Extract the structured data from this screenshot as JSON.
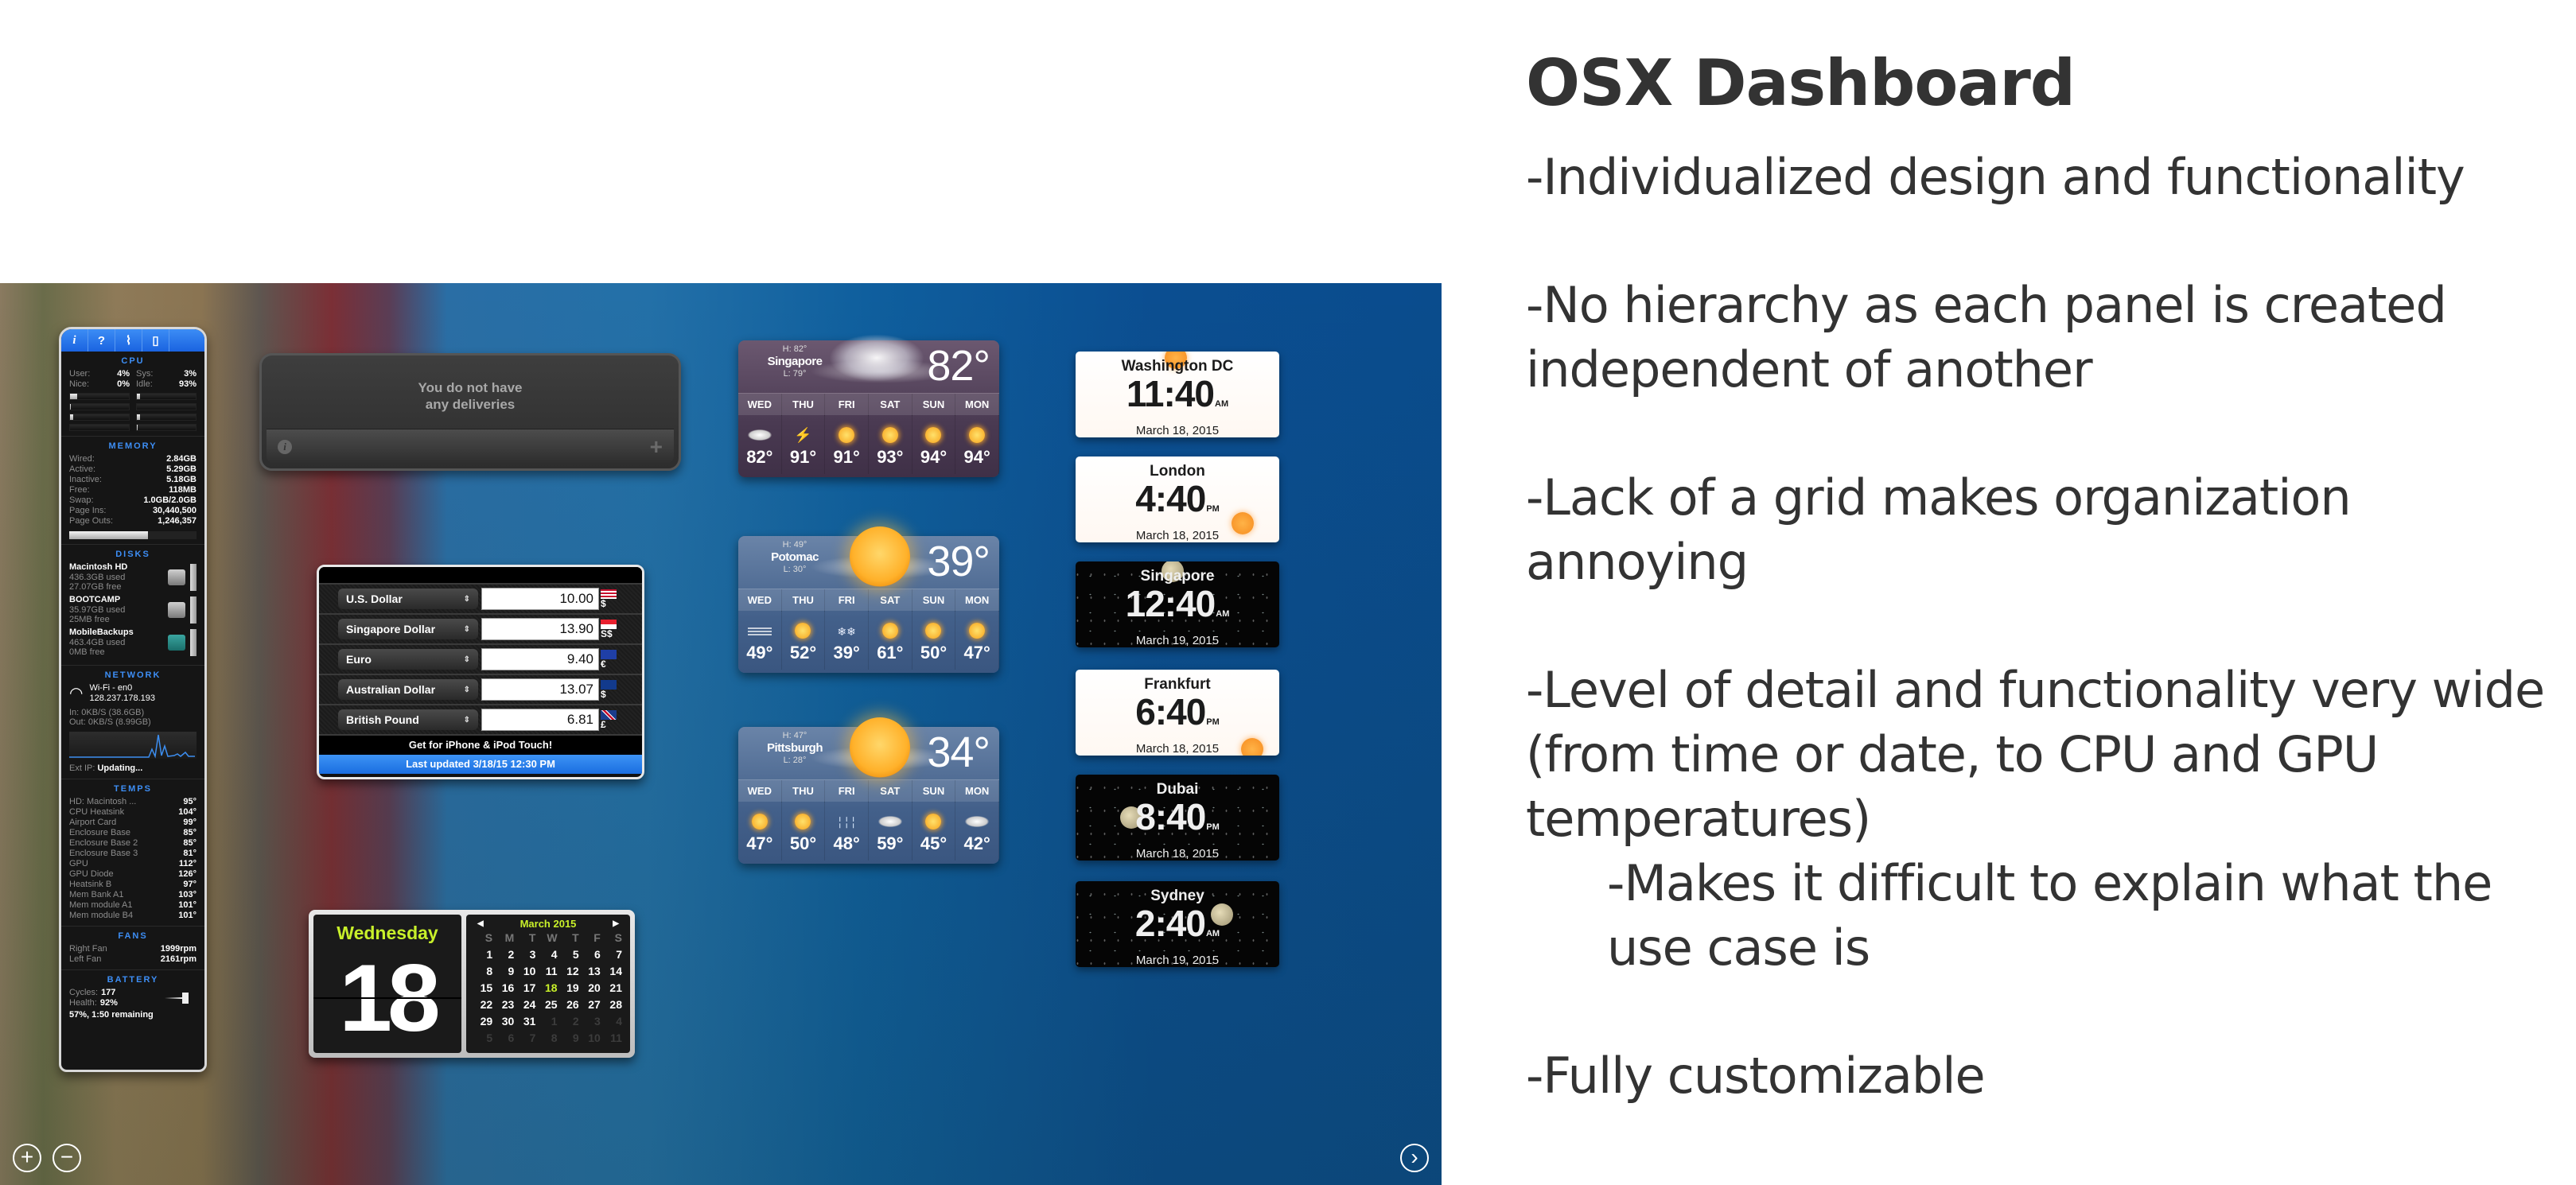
{
  "slide": {
    "title": "OSX Dashboard",
    "bullets": [
      "-Individualized design and functionality",
      "-No hierarchy as each panel is created independent of another",
      "-Lack of a grid makes organization annoying",
      "-Level of detail and functionality very wide (from time or date, to CPU and GPU temperatures)",
      "-Makes it difficult to explain what the use case is",
      "-Fully customizable"
    ]
  },
  "istat": {
    "tabs": [
      "i",
      "?",
      "activity",
      "device"
    ],
    "cpu": {
      "heading": "CPU",
      "user_label": "User:",
      "user": "4%",
      "sys_label": "Sys:",
      "sys": "3%",
      "nice_label": "Nice:",
      "nice": "0%",
      "idle_label": "Idle:",
      "idle": "93%",
      "core_loads_pct": [
        12,
        5,
        2,
        0,
        5,
        5,
        0,
        2
      ]
    },
    "memory": {
      "heading": "MEMORY",
      "rows": [
        {
          "label": "Wired:",
          "value": "2.84GB"
        },
        {
          "label": "Active:",
          "value": "5.29GB"
        },
        {
          "label": "Inactive:",
          "value": "5.18GB"
        },
        {
          "label": "Free:",
          "value": "118MB"
        },
        {
          "label": "Swap:",
          "value": "1.0GB/2.0GB"
        },
        {
          "label": "Page Ins:",
          "value": "30,440,500"
        },
        {
          "label": "Page Outs:",
          "value": "1,246,357"
        }
      ],
      "used_pct": 62
    },
    "disks": {
      "heading": "DISKS",
      "items": [
        {
          "name": "Macintosh HD",
          "used": "436.3GB used",
          "free": "27.07GB free"
        },
        {
          "name": "BOOTCAMP",
          "used": "35.97GB used",
          "free": "25MB free"
        },
        {
          "name": "MobileBackups",
          "used": "463.4GB used",
          "free": "0MB free"
        }
      ]
    },
    "network": {
      "heading": "NETWORK",
      "interface": "Wi-Fi - en0",
      "ip": "128.237.178.193",
      "in": "In: 0KB/S (38.6GB)",
      "out": "Out: 0KB/S (8.99GB)",
      "ext_ip_label": "Ext IP:",
      "ext_ip": "Updating..."
    },
    "temps": {
      "heading": "TEMPS",
      "rows": [
        {
          "label": "HD: Macintosh ...",
          "value": "95°"
        },
        {
          "label": "CPU Heatsink",
          "value": "104°"
        },
        {
          "label": "Airport Card",
          "value": "99°"
        },
        {
          "label": "Enclosure Base",
          "value": "85°"
        },
        {
          "label": "Enclosure Base 2",
          "value": "85°"
        },
        {
          "label": "Enclosure Base 3",
          "value": "81°"
        },
        {
          "label": "GPU",
          "value": "112°"
        },
        {
          "label": "GPU Diode",
          "value": "126°"
        },
        {
          "label": "Heatsink B",
          "value": "97°"
        },
        {
          "label": "Mem Bank A1",
          "value": "103°"
        },
        {
          "label": "Mem module A1",
          "value": "101°"
        },
        {
          "label": "Mem module B4",
          "value": "101°"
        }
      ]
    },
    "fans": {
      "heading": "FANS",
      "rows": [
        {
          "label": "Right Fan",
          "value": "1999rpm"
        },
        {
          "label": "Left Fan",
          "value": "2161rpm"
        }
      ]
    },
    "battery": {
      "heading": "BATTERY",
      "cycles_label": "Cycles:",
      "cycles": "177",
      "health_label": "Health:",
      "health": "92%",
      "status": "57%, 1:50 remaining"
    }
  },
  "delivery": {
    "message_line1": "You do not have",
    "message_line2": "any deliveries",
    "info_glyph": "i",
    "add_glyph": "+"
  },
  "currency": {
    "rows": [
      {
        "currency": "U.S. Dollar",
        "amount": "10.00",
        "symbol": "$",
        "flag": "us"
      },
      {
        "currency": "Singapore Dollar",
        "amount": "13.90",
        "symbol": "S$",
        "flag": "sg"
      },
      {
        "currency": "Euro",
        "amount": "9.40",
        "symbol": "€",
        "flag": "eu"
      },
      {
        "currency": "Australian Dollar",
        "amount": "13.07",
        "symbol": "$",
        "flag": "au"
      },
      {
        "currency": "British Pound",
        "amount": "6.81",
        "symbol": "£",
        "flag": "gb"
      }
    ],
    "promo": "Get for iPhone & iPod Touch!",
    "last_updated": "Last updated 3/18/15 12:30 PM",
    "select_arrows": "⇕"
  },
  "weather": [
    {
      "city": "Singapore",
      "high": "H: 82°",
      "low": "L: 79°",
      "current": "82°",
      "hero": "cloud",
      "theme": "purple",
      "forecast": [
        {
          "day": "WED",
          "icon": "cloudy",
          "temp": "82°"
        },
        {
          "day": "THU",
          "icon": "thunderstorm",
          "temp": "91°"
        },
        {
          "day": "FRI",
          "icon": "partly-sunny",
          "temp": "91°"
        },
        {
          "day": "SAT",
          "icon": "partly-sunny",
          "temp": "93°"
        },
        {
          "day": "SUN",
          "icon": "partly-sunny",
          "temp": "94°"
        },
        {
          "day": "MON",
          "icon": "partly-sunny",
          "temp": "94°"
        }
      ]
    },
    {
      "city": "Potomac",
      "high": "H: 49°",
      "low": "L: 30°",
      "current": "39°",
      "hero": "sun",
      "theme": "blue",
      "forecast": [
        {
          "day": "WED",
          "icon": "fog",
          "temp": "49°"
        },
        {
          "day": "THU",
          "icon": "partly-sunny",
          "temp": "52°"
        },
        {
          "day": "FRI",
          "icon": "snow",
          "temp": "39°"
        },
        {
          "day": "SAT",
          "icon": "partly-sunny",
          "temp": "61°"
        },
        {
          "day": "SUN",
          "icon": "partly-sunny",
          "temp": "50°"
        },
        {
          "day": "MON",
          "icon": "partly-sunny",
          "temp": "47°"
        }
      ]
    },
    {
      "city": "Pittsburgh",
      "high": "H: 47°",
      "low": "L: 28°",
      "current": "34°",
      "hero": "sun",
      "theme": "blue",
      "forecast": [
        {
          "day": "WED",
          "icon": "sunny",
          "temp": "47°"
        },
        {
          "day": "THU",
          "icon": "partly-sunny",
          "temp": "50°"
        },
        {
          "day": "FRI",
          "icon": "rain",
          "temp": "48°"
        },
        {
          "day": "SAT",
          "icon": "cloudy",
          "temp": "59°"
        },
        {
          "day": "SUN",
          "icon": "sunny",
          "temp": "45°"
        },
        {
          "day": "MON",
          "icon": "cloudy",
          "temp": "42°"
        }
      ]
    }
  ],
  "clocks": [
    {
      "city": "Washington DC",
      "time": "11:40",
      "ampm": "AM",
      "date": "March 18, 2015",
      "mode": "day",
      "orb": "sun"
    },
    {
      "city": "London",
      "time": "4:40",
      "ampm": "PM",
      "date": "March 18, 2015",
      "mode": "day",
      "orb": "sun"
    },
    {
      "city": "Singapore",
      "time": "12:40",
      "ampm": "AM",
      "date": "March 19, 2015",
      "mode": "night",
      "orb": "moon"
    },
    {
      "city": "Frankfurt",
      "time": "6:40",
      "ampm": "PM",
      "date": "March 18, 2015",
      "mode": "day",
      "orb": "sun"
    },
    {
      "city": "Dubai",
      "time": "8:40",
      "ampm": "PM",
      "date": "March 18, 2015",
      "mode": "night",
      "orb": "moon"
    },
    {
      "city": "Sydney",
      "time": "2:40",
      "ampm": "AM",
      "date": "March 19, 2015",
      "mode": "night",
      "orb": "moon"
    }
  ],
  "calendar": {
    "weekday": "Wednesday",
    "date": "18",
    "month_label": "March 2015",
    "prev_glyph": "◀",
    "next_glyph": "▶",
    "dow": [
      "S",
      "M",
      "T",
      "W",
      "T",
      "F",
      "S"
    ],
    "days": [
      [
        "1",
        "2",
        "3",
        "4",
        "5",
        "6",
        "7"
      ],
      [
        "8",
        "9",
        "10",
        "11",
        "12",
        "13",
        "14"
      ],
      [
        "15",
        "16",
        "17",
        "18",
        "19",
        "20",
        "21"
      ],
      [
        "22",
        "23",
        "24",
        "25",
        "26",
        "27",
        "28"
      ],
      [
        "29",
        "30",
        "31",
        "1",
        "2",
        "3",
        "4"
      ],
      [
        "5",
        "6",
        "7",
        "8",
        "9",
        "10",
        "11"
      ]
    ],
    "today": "18",
    "current_month_day_count": 31
  },
  "controls": {
    "add_glyph": "+",
    "remove_glyph": "−",
    "next_glyph": "›"
  }
}
